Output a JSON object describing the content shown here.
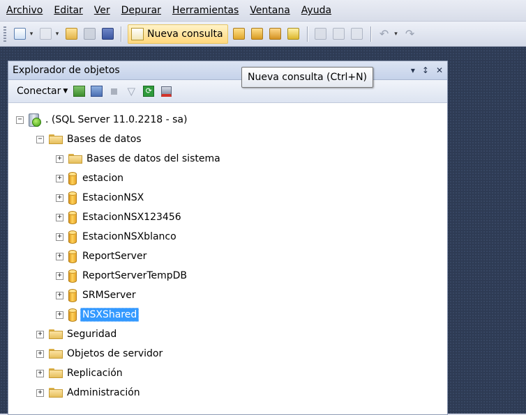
{
  "menu": [
    "Archivo",
    "Editar",
    "Ver",
    "Depurar",
    "Herramientas",
    "Ventana",
    "Ayuda"
  ],
  "toolbar": {
    "new_query_label": "Nueva consulta"
  },
  "tooltip": "Nueva consulta (Ctrl+N)",
  "object_explorer": {
    "title": "Explorador de objetos",
    "pin_glyph": "↕",
    "close_glyph": "✕",
    "dropdown_glyph": "▾",
    "connect_label": "Conectar",
    "tree": {
      "server": ". (SQL Server 11.0.2218 - sa)",
      "databases_folder": "Bases de datos",
      "system_databases": "Bases de datos del sistema",
      "databases": [
        "estacion",
        "EstacionNSX",
        "EstacionNSX123456",
        "EstacionNSXblanco",
        "ReportServer",
        "ReportServerTempDB",
        "SRMServer",
        "NSXShared"
      ],
      "selected_database": "NSXShared",
      "other_folders": [
        "Seguridad",
        "Objetos de servidor",
        "Replicación",
        "Administración"
      ]
    }
  },
  "colors": {
    "selection": "#3399ff",
    "background": "#2e3b54"
  }
}
